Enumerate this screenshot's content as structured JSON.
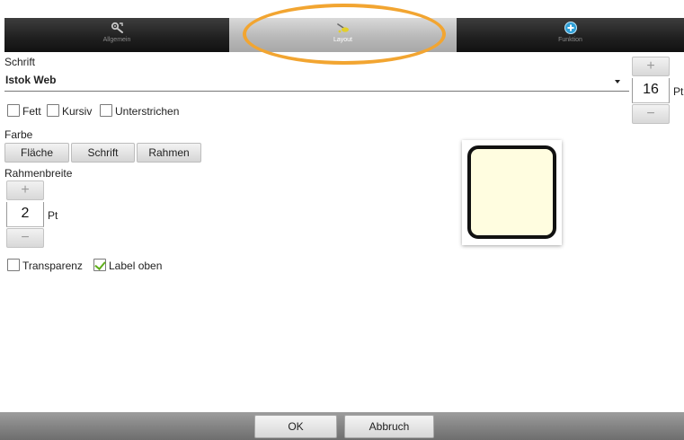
{
  "tabs": [
    {
      "label": "Allgemein",
      "icon": "settings-tools-icon",
      "active": false
    },
    {
      "label": "Layout",
      "icon": "paint-icon",
      "active": true
    },
    {
      "label": "Funktion",
      "icon": "plus-circle-icon",
      "active": false
    }
  ],
  "font": {
    "section_label": "Schrift",
    "selected_font": "Istok Web",
    "size_value": "16",
    "size_unit": "Pt",
    "plus_symbol": "+",
    "minus_symbol": "−"
  },
  "style_options": {
    "bold": {
      "label": "Fett",
      "checked": false
    },
    "italic": {
      "label": "Kursiv",
      "checked": false
    },
    "underline": {
      "label": "Unterstrichen",
      "checked": false
    }
  },
  "color": {
    "section_label": "Farbe",
    "buttons": {
      "fill": "Fläche",
      "font": "Schrift",
      "border": "Rahmen"
    }
  },
  "border_width": {
    "section_label": "Rahmenbreite",
    "value": "2",
    "unit": "Pt",
    "plus_symbol": "+",
    "minus_symbol": "−"
  },
  "options": {
    "transparency": {
      "label": "Transparenz",
      "checked": false
    },
    "label_top": {
      "label": "Label oben",
      "checked": true
    }
  },
  "preview": {
    "fill_color": "#fffde0",
    "border_color": "#111111"
  },
  "footer": {
    "ok_label": "OK",
    "cancel_label": "Abbruch"
  },
  "colors": {
    "highlight": "#f2a531",
    "check": "#5fae1a",
    "active_tab": "#b9b9b9",
    "inactive_tab": "#1f1f1f"
  }
}
